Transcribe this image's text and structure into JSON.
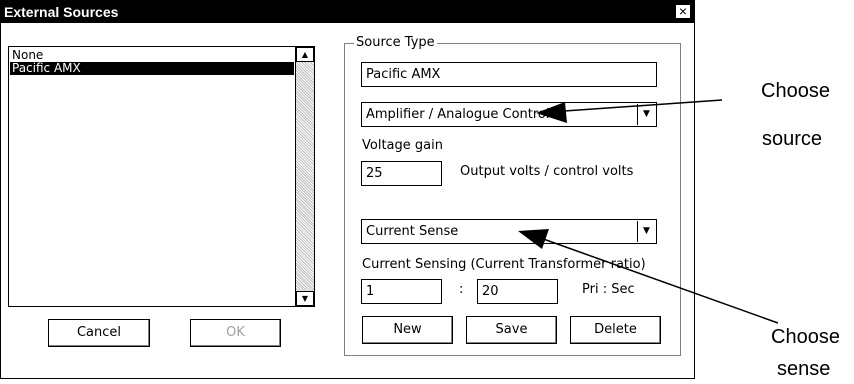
{
  "window": {
    "title": "External Sources",
    "close_glyph": "×"
  },
  "source_list": {
    "items": [
      {
        "label": "None",
        "selected": false
      },
      {
        "label": "Pacific AMX",
        "selected": true
      }
    ],
    "scroll_up": "▲",
    "scroll_down": "▼"
  },
  "buttons": {
    "cancel": "Cancel",
    "ok": "OK",
    "new": "New",
    "save": "Save",
    "delete": "Delete"
  },
  "source_type": {
    "group_label": "Source Type",
    "name_value": "Pacific AMX",
    "control_select": "Amplifier / Analogue Control",
    "voltage_gain_label": "Voltage gain",
    "voltage_gain_value": "25",
    "voltage_units": "Output volts / control volts",
    "sense_select": "Current Sense",
    "ct_label": "Current Sensing (Current Transformer ratio)",
    "ct_primary": "1",
    "ct_colon": ":",
    "ct_secondary": "20",
    "ct_units": "Pri : Sec"
  },
  "annotations": {
    "choose_source_1": "Choose",
    "choose_source_2": "source",
    "choose_sense_1": "Choose",
    "choose_sense_2": "sense"
  },
  "icons": {
    "dropdown": "▼"
  }
}
